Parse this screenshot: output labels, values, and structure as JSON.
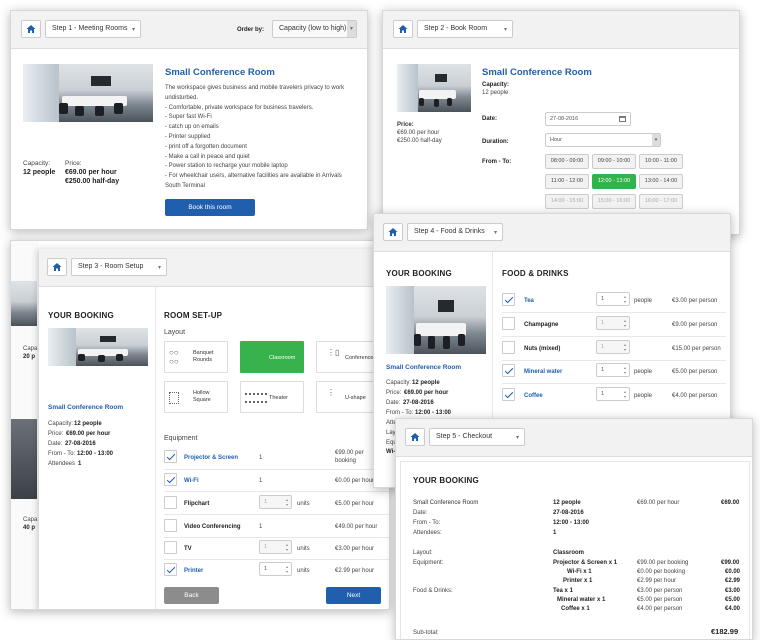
{
  "panel1": {
    "step": "Step 1 - Meeting Rooms",
    "order_label": "Order by:",
    "order_value": "Capacity (low to high)",
    "room_title": "Small Conference Room",
    "desc": [
      "The workspace gives business and mobile travelers privacy to work",
      "undisturbed.",
      "- Comfortable, private workspace for business travelers.",
      "- Super fast Wi-Fi",
      "- catch up on emails",
      "- Printer supplied",
      "- print off a forgotten document",
      "- Make a call in peace and quiet",
      "- Power station to recharge your mobile laptop",
      "- For wheelchair users, alternative facilities are available in Arrivals",
      "South Terminal"
    ],
    "capacity_label": "Capacity:",
    "capacity_value": "12 people",
    "price_label": "Price:",
    "price_hour": "€69.00 per hour",
    "price_half": "€250.00 half-day",
    "book_button": "Book this room"
  },
  "panel2": {
    "step": "Step 2 - Book Room",
    "room_title": "Small Conference Room",
    "capacity_label": "Capacity:",
    "capacity_value": "12 people",
    "price_label": "Price:",
    "price_hour": "€69.00 per hour",
    "price_half": "€250.00 half-day",
    "date_label": "Date:",
    "date_value": "27-08-2016",
    "duration_label": "Duration:",
    "duration_value": "Hour",
    "fromto_label": "From - To:",
    "slots": [
      "08:00 - 09:00",
      "09:00 - 10:00",
      "10:00 - 11:00",
      "11:00 - 12:00",
      "12:00 - 13:00",
      "13:00 - 14:00",
      "14:00 - 15:00",
      "15:00 - 16:00",
      "16:00 - 17:00"
    ]
  },
  "panel3": {
    "step": "Step 3 - Room Setup",
    "your_booking": "YOUR BOOKING",
    "room_title": "Small Conference Room",
    "capacity_label": "Capacity:",
    "capacity_value": "12 people",
    "price_label": "Price:",
    "price_value": "€69.00 per hour",
    "date_label": "Date:",
    "date_value": "27-08-2016",
    "fromto_label": "From - To:",
    "fromto_value": "12:00 - 13:00",
    "attendees_label": "Attendees",
    "attendees_value": "1",
    "room_setup": "ROOM SET-UP",
    "layout_label": "Layout",
    "layouts": [
      "Banquet Rounds",
      "Classroom",
      "Conference",
      "Hollow Square",
      "Theater",
      "U-shape"
    ],
    "equipment_label": "Equipment",
    "equipment": [
      {
        "name": "Projector & Screen",
        "qty": "1",
        "units": "",
        "price": "€99.00 per booking"
      },
      {
        "name": "Wi-Fi",
        "qty": "1",
        "units": "",
        "price": "€0.00 per hour"
      },
      {
        "name": "Flipchart",
        "qty": "1",
        "units": "units",
        "price": "€5.00 per hour"
      },
      {
        "name": "Video Conferencing",
        "qty": "1",
        "units": "",
        "price": "€49.00 per hour"
      },
      {
        "name": "TV",
        "qty": "1",
        "units": "units",
        "price": "€3.00 per hour"
      },
      {
        "name": "Printer",
        "qty": "1",
        "units": "units",
        "price": "€2.99 per hour"
      }
    ],
    "back_button": "Back",
    "next_button": "Next",
    "behind_capacity_label": "Capa",
    "behind_capacity_value": "20 p",
    "behind_capacity_label2": "Capa",
    "behind_capacity_value2": "40 p"
  },
  "panel4": {
    "step": "Step 4 - Food & Drinks",
    "your_booking": "YOUR BOOKING",
    "room_title": "Small Conference Room",
    "capacity_label": "Capacity:",
    "capacity_value": "12 people",
    "price_label": "Price:",
    "price_value": "€69.00 per hour",
    "date_label": "Date:",
    "date_value": "27-08-2016",
    "fromto_label": "From - To:",
    "fromto_value": "12:00 - 13:00",
    "cut_rows": [
      "Atte",
      "Layo",
      "Equ",
      "Wi-"
    ],
    "food_title": "FOOD & DRINKS",
    "people_word": "people",
    "items": [
      {
        "name": "Tea",
        "qty": "1",
        "price": "€3.00 per person"
      },
      {
        "name": "Champagne",
        "qty": "1",
        "price": "€9.00 per person"
      },
      {
        "name": "Nuts (mixed)",
        "qty": "1",
        "price": "€15.00 per person"
      },
      {
        "name": "Mineral water",
        "qty": "1",
        "price": "€5.00 per person"
      },
      {
        "name": "Coffee",
        "qty": "1",
        "price": "€4.00 per person"
      }
    ]
  },
  "panel5": {
    "step": "Step 5 - Checkout",
    "your_booking": "YOUR BOOKING",
    "room": "Small Conference Room",
    "room_people": "12 people",
    "room_rate": "€69.00 per hour",
    "room_total": "€69.00",
    "date_label": "Date:",
    "date_value": "27-08-2016",
    "fromto_label": "From - To:",
    "fromto_value": "12:00 - 13:00",
    "attendees_label": "Attendees:",
    "attendees_value": "1",
    "layout_label": "Layout:",
    "layout_value": "Classroom",
    "equipment_label": "Equipment:",
    "equipment": [
      {
        "name": "Projector & Screen x 1",
        "rate": "€99.00 per booking",
        "total": "€99.00"
      },
      {
        "name": "Wi-Fi x 1",
        "rate": "€0.00 per booking",
        "total": "€0.00"
      },
      {
        "name": "Printer x 1",
        "rate": "€2.99 per hour",
        "total": "€2.99"
      }
    ],
    "food_label": "Food & Drinks:",
    "food": [
      {
        "name": "Tea x 1",
        "rate": "€3.00 per person",
        "total": "€3.00"
      },
      {
        "name": "Mineral water x 1",
        "rate": "€5.00 per person",
        "total": "€5.00"
      },
      {
        "name": "Coffee x 1",
        "rate": "€4.00 per person",
        "total": "€4.00"
      }
    ],
    "subtotal_label": "Sub-total:",
    "subtotal_value": "€182.99"
  }
}
